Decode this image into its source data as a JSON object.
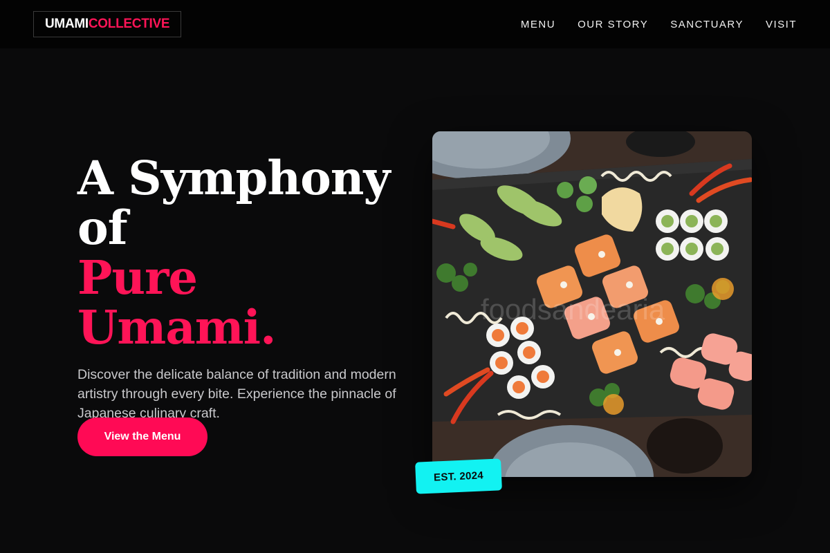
{
  "brand": {
    "part1": "UMAMI",
    "part2": "COLLECTIVE",
    "accent_color": "#ff1457"
  },
  "nav": {
    "items": [
      "MENU",
      "OUR STORY",
      "SANCTUARY",
      "VISIT"
    ]
  },
  "hero": {
    "line1": "A Symphony",
    "line2": "of",
    "line3": "Pure Umami.",
    "description": "Discover the delicate balance of tradition and modern artistry through every bite. Experience the pinnacle of Japanese culinary craft.",
    "cta_label": "View the Menu",
    "cta_color": "#ff0a55"
  },
  "photo": {
    "subject": "sushi platter on slate board",
    "watermark": "foodsandearia"
  },
  "badge": {
    "label": "EST. 2024",
    "color": "#12f2f2"
  }
}
